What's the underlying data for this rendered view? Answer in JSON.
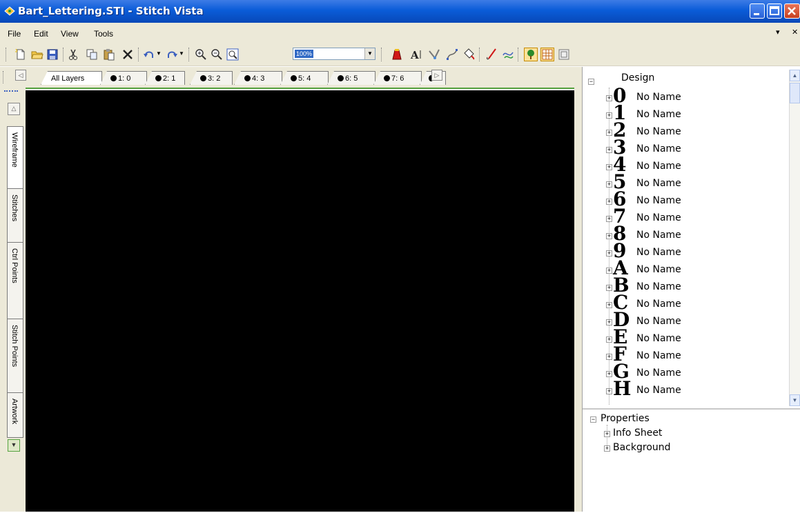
{
  "window": {
    "title": "Bart_Lettering.STI - Stitch Vista",
    "controls": {
      "minimize": "minimize-icon",
      "maximize": "maximize-icon",
      "close": "close-icon"
    }
  },
  "menu": {
    "items": [
      "File",
      "Edit",
      "View",
      "Tools"
    ],
    "overflow_glyph": "▾",
    "close_glyph": "✕"
  },
  "toolbar": {
    "zoom_value": "100%",
    "icons": [
      "new-icon",
      "open-icon",
      "save-icon",
      "cut-icon",
      "copy-icon",
      "paste-icon",
      "delete-icon",
      "undo-icon",
      "redo-icon",
      "zoom-in-icon",
      "zoom-out-icon",
      "zoom-fit-icon",
      "color-icon",
      "text-icon",
      "stitch-tool-icon",
      "path-tool-icon",
      "fill-icon",
      "needle-icon",
      "thread-icon",
      "tree-view-icon",
      "grid-view-icon",
      "preview-icon"
    ]
  },
  "layer_tabs": [
    {
      "label": "All Layers",
      "dot": false
    },
    {
      "label": "1: 0",
      "dot": true
    },
    {
      "label": "2: 1",
      "dot": true
    },
    {
      "label": "3: 2",
      "dot": true
    },
    {
      "label": "4: 3",
      "dot": true
    },
    {
      "label": "5: 4",
      "dot": true
    },
    {
      "label": "6: 5",
      "dot": true
    },
    {
      "label": "7: 6",
      "dot": true
    }
  ],
  "side_tabs": [
    "Wireframe",
    "Stitches",
    "Ctrl Points",
    "Stitch Points",
    "Artwork"
  ],
  "design_tree": {
    "root": "Design",
    "items": [
      {
        "glyph": "0",
        "label": "No Name"
      },
      {
        "glyph": "1",
        "label": "No Name"
      },
      {
        "glyph": "2",
        "label": "No Name"
      },
      {
        "glyph": "3",
        "label": "No Name"
      },
      {
        "glyph": "4",
        "label": "No Name"
      },
      {
        "glyph": "5",
        "label": "No Name"
      },
      {
        "glyph": "6",
        "label": "No Name"
      },
      {
        "glyph": "7",
        "label": "No Name"
      },
      {
        "glyph": "8",
        "label": "No Name"
      },
      {
        "glyph": "9",
        "label": "No Name"
      },
      {
        "glyph": "A",
        "label": "No Name"
      },
      {
        "glyph": "B",
        "label": "No Name"
      },
      {
        "glyph": "C",
        "label": "No Name"
      },
      {
        "glyph": "D",
        "label": "No Name"
      },
      {
        "glyph": "E",
        "label": "No Name"
      },
      {
        "glyph": "F",
        "label": "No Name"
      },
      {
        "glyph": "G",
        "label": "No Name"
      },
      {
        "glyph": "H",
        "label": "No Name"
      }
    ]
  },
  "properties": {
    "root": "Properties",
    "items": [
      "Info Sheet",
      "Background"
    ]
  }
}
